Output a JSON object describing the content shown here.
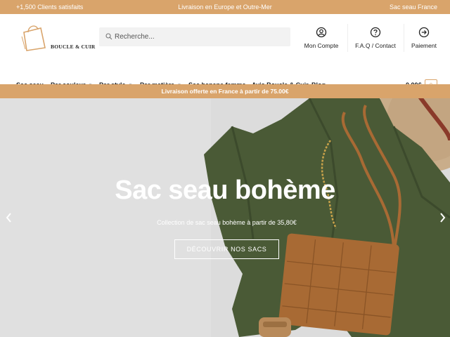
{
  "topbar": {
    "left": "+1,500 Clients satisfaits",
    "center": "Livraison en Europe et Outre-Mer",
    "right": "Sac seau France"
  },
  "header": {
    "logo_text": "BOUCLE & CUIR",
    "search_placeholder": "Recherche...",
    "account_label": "Mon Compte",
    "faq_label": "F.A.Q / Contact",
    "payment_label": "Paiement"
  },
  "nav": {
    "items": [
      {
        "label": "Sac seau",
        "dropdown": false
      },
      {
        "label": "Par couleur",
        "dropdown": true
      },
      {
        "label": "Par style",
        "dropdown": true
      },
      {
        "label": "Par matière",
        "dropdown": true
      },
      {
        "label": "Sac banane femme",
        "dropdown": false
      },
      {
        "label": "Avis Boucle & Cuir",
        "dropdown": false
      },
      {
        "label": "Blog",
        "dropdown": false
      }
    ],
    "cart_total": "0.00€",
    "cart_count": "0"
  },
  "promo": {
    "text": "Livraison offerte en France à partir de 75.00€"
  },
  "hero": {
    "title": "Sac seau bohème",
    "subtitle": "Collection de sac seau bohème à partir de 35,80€",
    "cta": "DÉCOUVRIR NOS SACS"
  },
  "colors": {
    "accent": "#d9a46b",
    "dress": "#4a5a36",
    "bag": "#a86a34"
  },
  "icons": {
    "search": "search-icon",
    "account": "user-circle-icon",
    "faq": "question-circle-icon",
    "payment": "arrow-right-circle-icon",
    "prev": "chevron-left-icon",
    "next": "chevron-right-icon"
  }
}
